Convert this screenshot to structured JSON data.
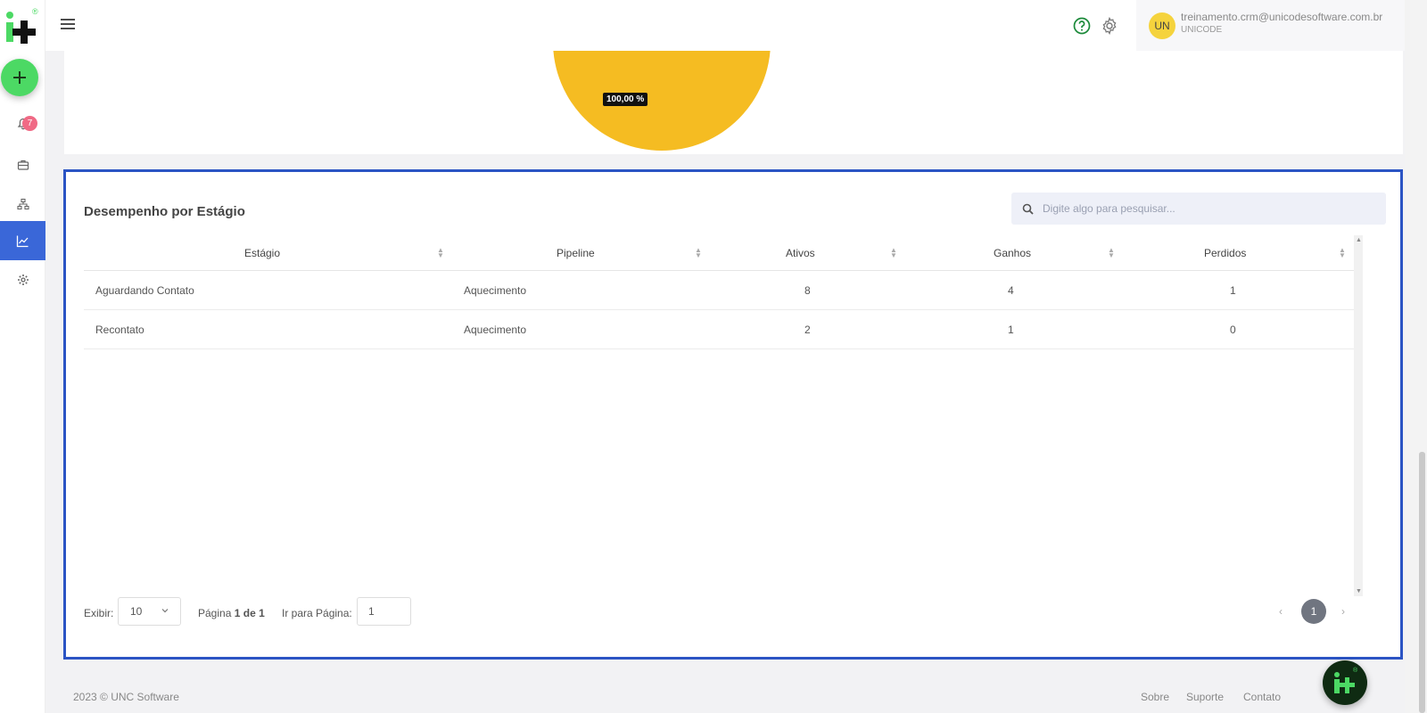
{
  "brand": {
    "logo_mark": "i+",
    "registered": "®"
  },
  "sidebar": {
    "notification_count": "7",
    "items": [
      {
        "name": "notifications",
        "icon": "bell-icon"
      },
      {
        "name": "briefcase",
        "icon": "briefcase-icon"
      },
      {
        "name": "org-chart",
        "icon": "hierarchy-icon"
      },
      {
        "name": "reports",
        "icon": "chart-line-icon",
        "active": true
      },
      {
        "name": "settings",
        "icon": "gear-icon"
      }
    ]
  },
  "header": {
    "user_initials": "UN",
    "user_email": "treinamento.crm@unicodesoftware.com.br",
    "user_company": "UNICODE"
  },
  "pie_chart": {
    "label": "100,00 %",
    "color": "#f5bc22"
  },
  "table": {
    "title": "Desempenho por Estágio",
    "search_placeholder": "Digite algo para pesquisar...",
    "columns": [
      "Estágio",
      "Pipeline",
      "Ativos",
      "Ganhos",
      "Perdidos"
    ],
    "rows": [
      [
        "Aguardando Contato",
        "Aquecimento",
        "8",
        "4",
        "1"
      ],
      [
        "Recontato",
        "Aquecimento",
        "2",
        "1",
        "0"
      ]
    ],
    "pager": {
      "show_label": "Exibir:",
      "page_size": "10",
      "page_label": "Página",
      "page_current": "1",
      "page_of": "de",
      "page_total": "1",
      "goto_label": "Ir para Página:",
      "goto_value": "1",
      "current_page_button": "1"
    }
  },
  "footer": {
    "copyright": "2023 © UNC Software",
    "links": [
      "Sobre",
      "Suporte",
      "Contato"
    ]
  },
  "colors": {
    "accent": "#3a67d8",
    "brand_green": "#4cd964",
    "highlight_border": "#2b54c4",
    "badge": "#f06a85"
  }
}
